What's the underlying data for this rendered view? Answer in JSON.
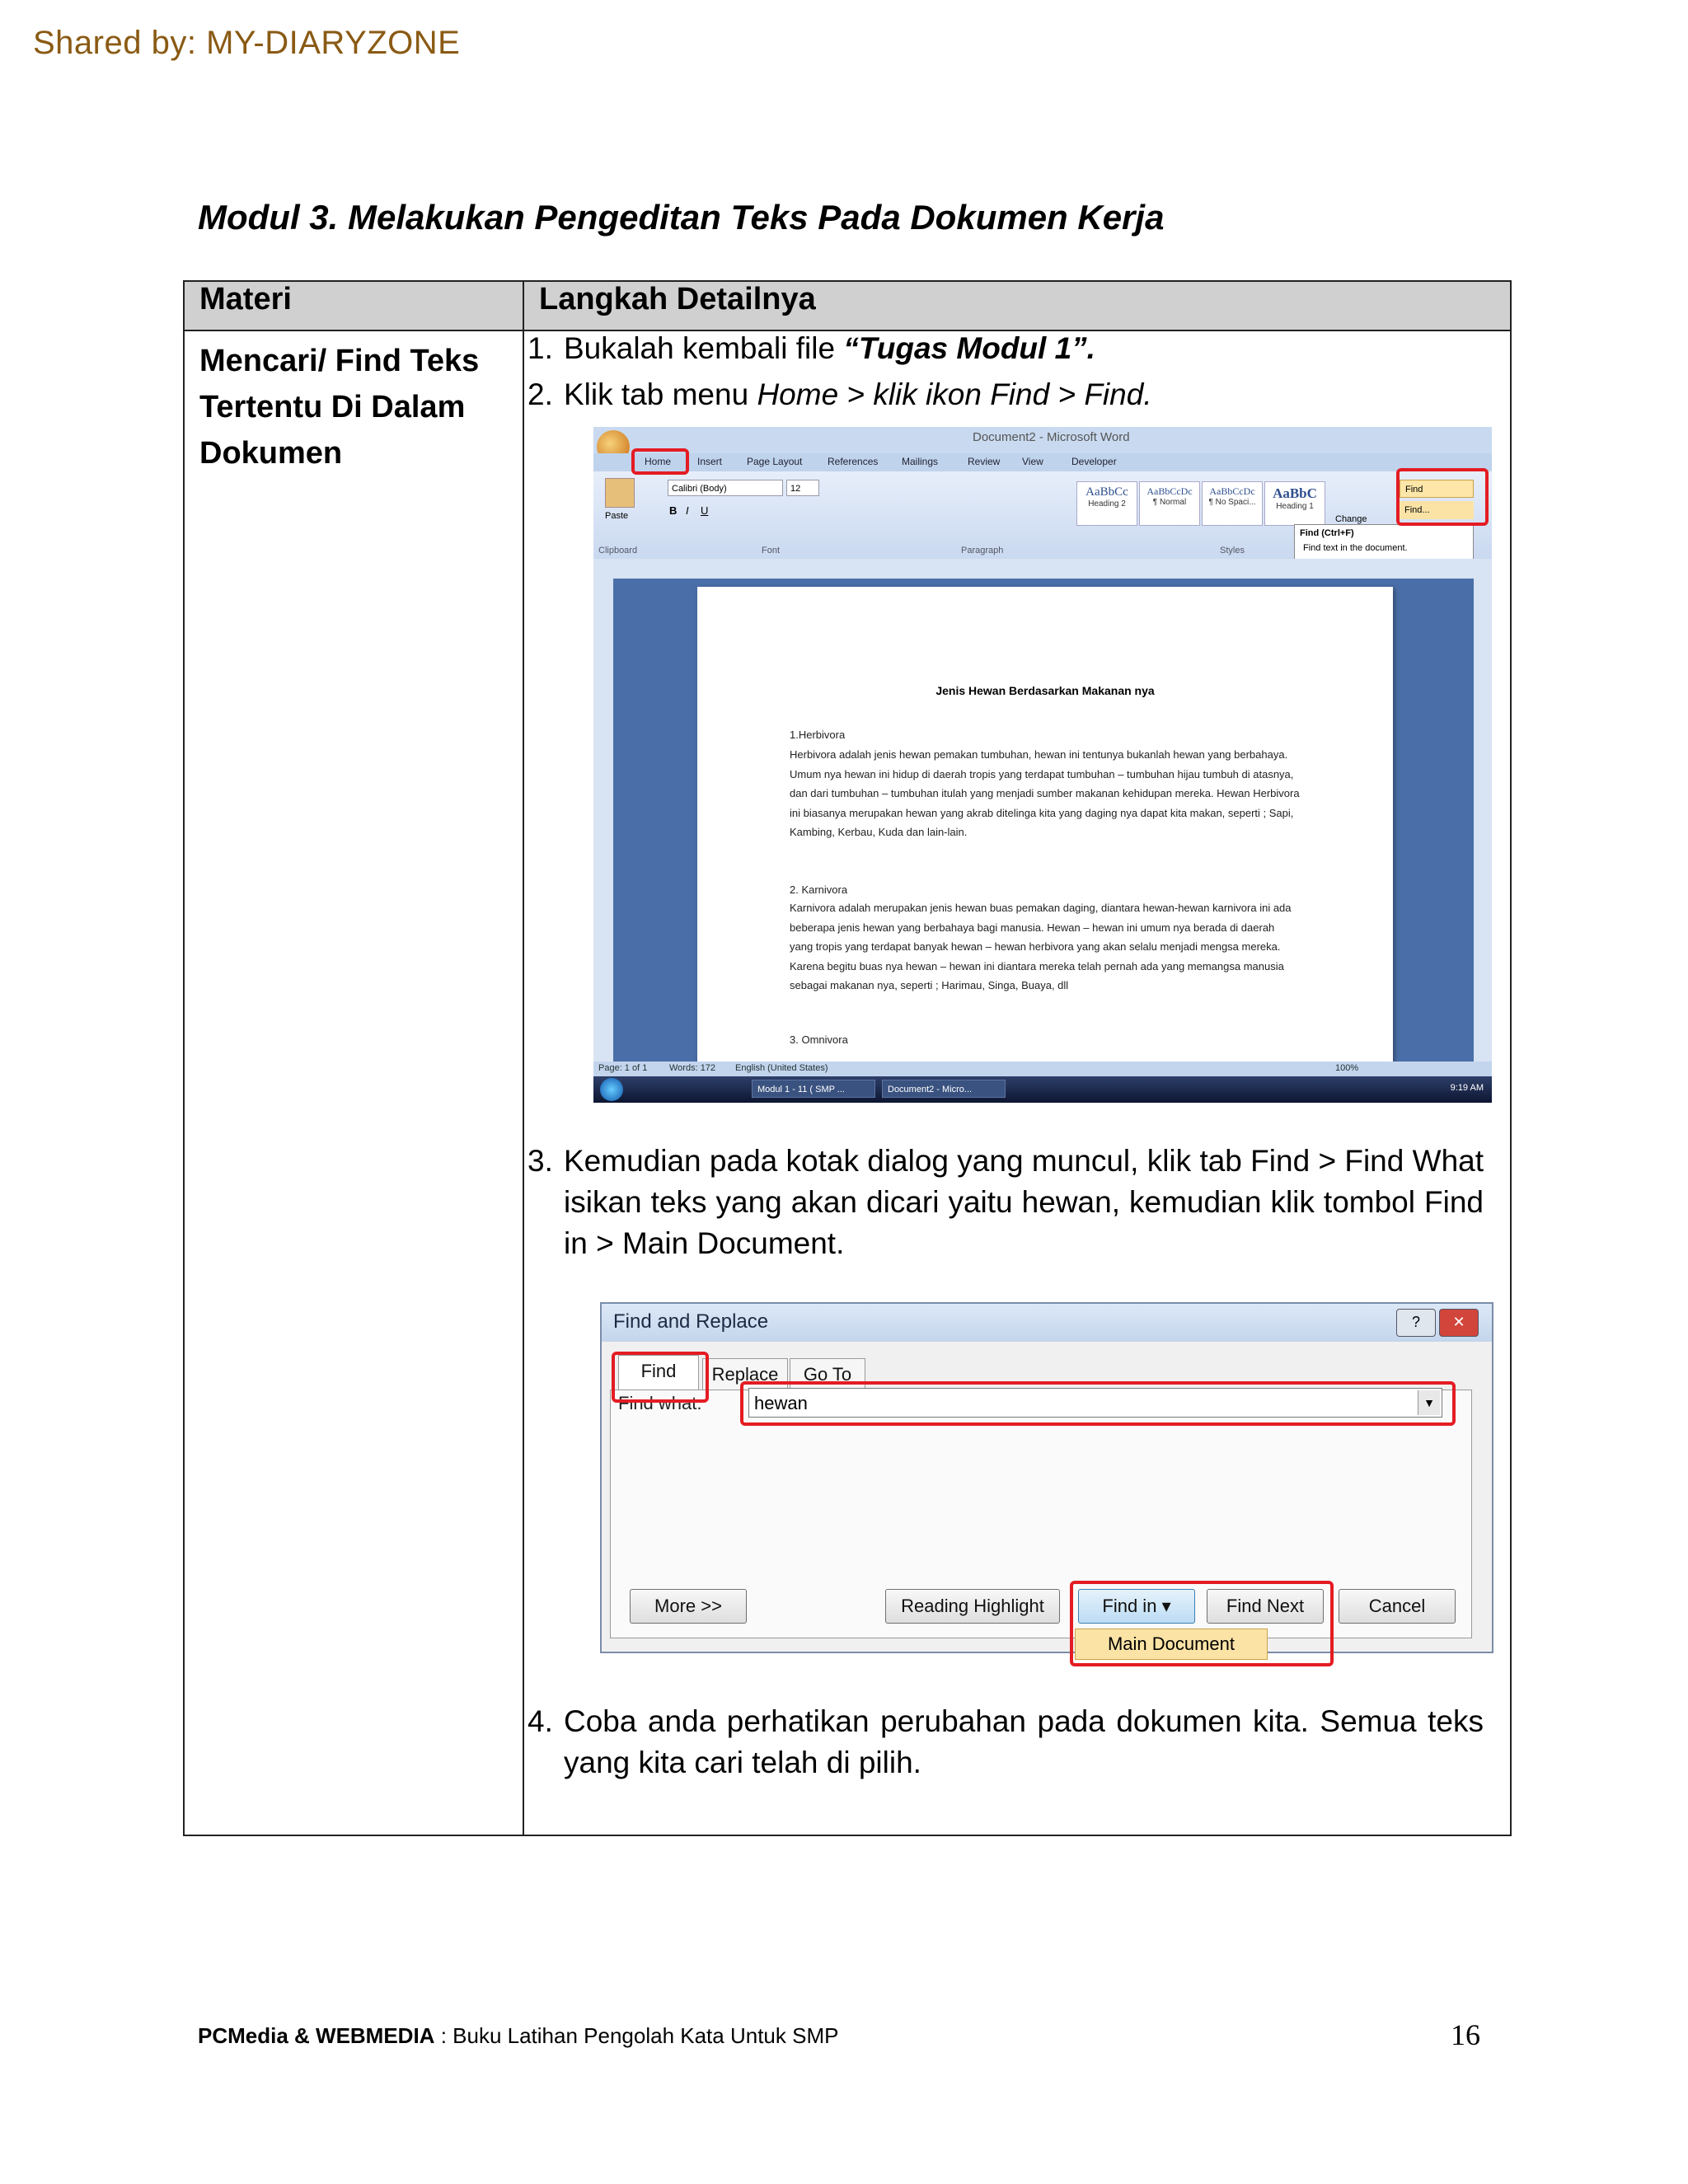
{
  "watermark": "Shared by: MY-DIARYZONE",
  "title": "Modul 3. Melakukan Pengeditan Teks Pada Dokumen Kerja",
  "table": {
    "header_col1": "Materi",
    "header_col2": "Langkah Detailnya",
    "materi_lines": [
      "Mencari/ Find Teks",
      "Tertentu Di Dalam",
      "Dokumen"
    ],
    "steps": [
      {
        "num": "1.",
        "before": "Bukalah kembali file ",
        "bold_italic": "“Tugas Modul 1”."
      },
      {
        "num": "2.",
        "before": "Klik tab menu ",
        "italic": "Home > klik ikon Find > Find."
      },
      {
        "num": "3.",
        "text": "Kemudian pada kotak dialog yang muncul, klik tab Find > Find What isikan teks yang akan dicari yaitu hewan, kemudian klik tombol Find in > Main Document."
      },
      {
        "num": "4.",
        "text": "Coba anda perhatikan perubahan pada dokumen kita. Semua teks yang kita cari telah di pilih."
      }
    ]
  },
  "word_screenshot": {
    "window_title": "Document2 - Microsoft Word",
    "tabs": [
      "Home",
      "Insert",
      "Page Layout",
      "References",
      "Mailings",
      "Review",
      "View",
      "Developer"
    ],
    "font_name": "Calibri (Body)",
    "font_size": "12",
    "groups": [
      "Clipboard",
      "Font",
      "Paragraph",
      "Styles"
    ],
    "paste_label": "Paste",
    "styles": [
      {
        "sample": "AaBbCc",
        "name": "Heading 2"
      },
      {
        "sample": "AaBbCcDc",
        "name": "¶ Normal"
      },
      {
        "sample": "AaBbCcDc",
        "name": "¶ No Spaci..."
      },
      {
        "sample": "AaBbC",
        "name": "Heading 1"
      }
    ],
    "change_styles": "Change",
    "find_button": "Find",
    "find_menu_item": "Find...",
    "tooltip_title": "Find (Ctrl+F)",
    "tooltip_text": "Find text in the document.",
    "doc_title": "Jenis Hewan Berdasarkan Makanan nya",
    "doc_paragraphs": [
      "1.Herbivora",
      "Herbivora adalah jenis hewan pemakan tumbuhan, hewan ini tentunya bukanlah hewan yang berbahaya. Umum nya hewan ini hidup di daerah tropis yang terdapat tumbuhan – tumbuhan hijau tumbuh di atasnya, dan dari tumbuhan – tumbuhan itulah yang menjadi sumber makanan kehidupan mereka. Hewan Herbivora ini biasanya merupakan hewan yang akrab ditelinga kita yang daging nya dapat kita makan, seperti ; Sapi, Kambing, Kerbau, Kuda dan lain-lain.",
      "2. Karnivora",
      "Karnivora adalah merupakan jenis hewan buas pemakan daging, diantara hewan-hewan karnivora ini ada beberapa jenis hewan yang berbahaya bagi manusia. Hewan – hewan ini umum nya berada di daerah yang tropis yang terdapat banyak hewan – hewan herbivora yang akan selalu menjadi mengsa mereka. Karena begitu buas nya hewan – hewan ini diantara mereka telah pernah ada yang memangsa manusia sebagai makanan nya, seperti ; Harimau, Singa, Buaya, dll",
      "3. Omnivora"
    ],
    "status_page": "Page: 1 of 1",
    "status_words": "Words: 172",
    "status_lang": "English (United States)",
    "zoom": "100%",
    "task_items": [
      "Modul 1 - 11 ( SMP ...",
      "Document2 - Micro..."
    ],
    "clock": "9:19 AM"
  },
  "find_dialog": {
    "title": "Find and Replace",
    "help_btn": "?",
    "close_btn": "✕",
    "tabs": [
      "Find",
      "Replace",
      "Go To"
    ],
    "find_what_label": "Find what:",
    "find_what_value": "hewan",
    "buttons": {
      "more": "More >>",
      "reading_highlight": "Reading Highlight",
      "find_in": "Find in",
      "find_next": "Find Next",
      "cancel": "Cancel"
    },
    "dropdown_item": "Main Document"
  },
  "footer": {
    "brand": "PCMedia & WEBMEDIA",
    "sep": " : ",
    "book": "Buku Latihan Pengolah Kata Untuk SMP",
    "page_number": "16"
  },
  "colors": {
    "highlight_red": "#e41c23",
    "watermark": "#8a5a14",
    "header_fill": "#d0d0d0"
  }
}
